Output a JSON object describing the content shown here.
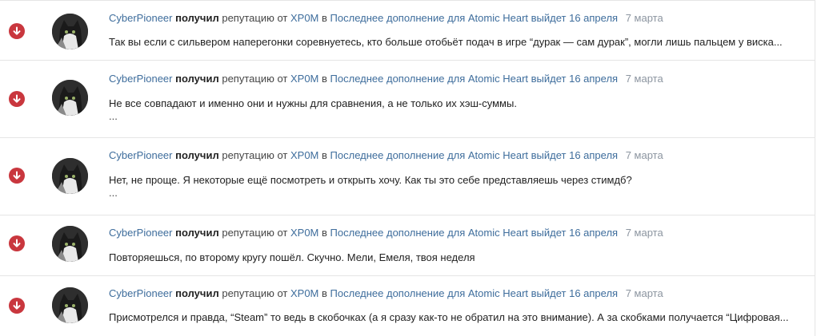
{
  "feed": {
    "items": [
      {
        "user": "CyberPioneer",
        "action": "получил",
        "rep_text": "репутацию от",
        "from_user": "XP0M",
        "in_text": "в",
        "topic": "Последнее дополнение для Atomic Heart выйдет 16 апреля",
        "date": "7 марта",
        "snippet": "Так вы если с сильвером наперегонки соревнуетесь, кто больше отобьёт подач в игре “дурак — сам дурак”, могли лишь пальцем у виска...",
        "more": ""
      },
      {
        "user": "CyberPioneer",
        "action": "получил",
        "rep_text": "репутацию от",
        "from_user": "XP0M",
        "in_text": "в",
        "topic": "Последнее дополнение для Atomic Heart выйдет 16 апреля",
        "date": "7 марта",
        "snippet": "Не все совпадают и именно они и нужны для сравнения, а не только их хэш-суммы.",
        "more": "..."
      },
      {
        "user": "CyberPioneer",
        "action": "получил",
        "rep_text": "репутацию от",
        "from_user": "XP0M",
        "in_text": "в",
        "topic": "Последнее дополнение для Atomic Heart выйдет 16 апреля",
        "date": "7 марта",
        "snippet": "Нет, не проще. Я некоторые ещё посмотреть и открыть хочу. Как ты это себе представляешь через стимдб?",
        "more": "..."
      },
      {
        "user": "CyberPioneer",
        "action": "получил",
        "rep_text": "репутацию от",
        "from_user": "XP0M",
        "in_text": "в",
        "topic": "Последнее дополнение для Atomic Heart выйдет 16 апреля",
        "date": "7 марта",
        "snippet": "Повторяешься, по второму кругу пошёл. Скучно.  Мели, Емеля, твоя неделя",
        "more": ""
      },
      {
        "user": "CyberPioneer",
        "action": "получил",
        "rep_text": "репутацию от",
        "from_user": "XP0M",
        "in_text": "в",
        "topic": "Последнее дополнение для Atomic Heart выйдет 16 апреля",
        "date": "7 марта",
        "snippet": "Присмотрелся и правда, “Steam” то ведь в скобочках (а я сразу как-то не обратил на это внимание). А за скобками получается “Цифровая...",
        "more": ""
      }
    ]
  },
  "colors": {
    "rep_negative": "#c9373e",
    "link": "#3e6d9c",
    "date": "#8c95a0",
    "border": "#e5e5e5"
  }
}
